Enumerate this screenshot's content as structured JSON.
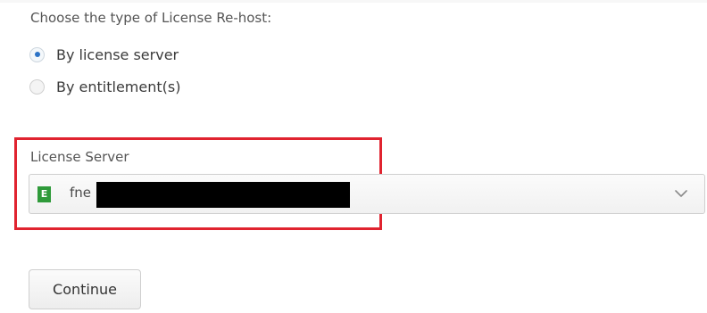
{
  "rehost": {
    "prompt": "Choose the type of License Re-host:",
    "options": [
      {
        "label": "By license server",
        "selected": true
      },
      {
        "label": "By entitlement(s)",
        "selected": false
      }
    ]
  },
  "license_server": {
    "label": "License Server",
    "badge": "E",
    "value": "fne",
    "value_redacted": true
  },
  "actions": {
    "continue_label": "Continue"
  },
  "colors": {
    "highlight": "#e0232f",
    "radio_selected": "#2d73c6",
    "badge": "#2f9a3a"
  }
}
